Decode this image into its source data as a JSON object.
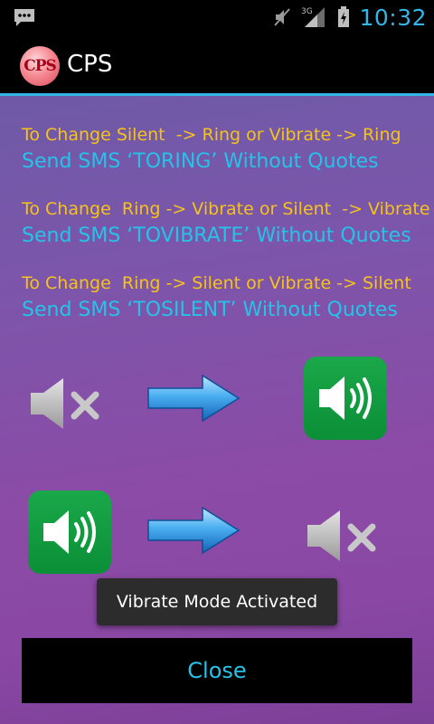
{
  "status_bar": {
    "time": "10:32",
    "network": "3G",
    "icons": [
      "sms-notification-icon",
      "vibrate-mode-icon",
      "signal-icon",
      "battery-charging-icon"
    ]
  },
  "action_bar": {
    "logo_text": "CPS",
    "title": "CPS",
    "accent": "#33b5e5"
  },
  "instructions": [
    {
      "line1": "To Change Silent  -> Ring or Vibrate -> Ring",
      "line2": "Send SMS ‘TORING’ Without Quotes"
    },
    {
      "line1": "To Change  Ring -> Vibrate or Silent  -> Vibrate",
      "line2": "Send SMS ‘TOVIBRATE’ Without Quotes"
    },
    {
      "line1": "To Change  Ring -> Silent or Vibrate -> Silent",
      "line2": "Send SMS ‘TOSILENT’ Without Quotes"
    }
  ],
  "diagram": {
    "row1": [
      "muted-speaker-icon",
      "arrow-right-icon",
      "speaker-on-icon"
    ],
    "row2": [
      "speaker-on-icon",
      "arrow-right-icon",
      "muted-speaker-icon"
    ]
  },
  "toast": {
    "text": "Vibrate Mode Activated"
  },
  "close_button": {
    "label": "Close"
  },
  "colors": {
    "instruction_heading": "#f6c21c",
    "instruction_sms": "#26c3e9",
    "tile_green": "#0b8f37",
    "background_purple": "#8b4ba6"
  }
}
